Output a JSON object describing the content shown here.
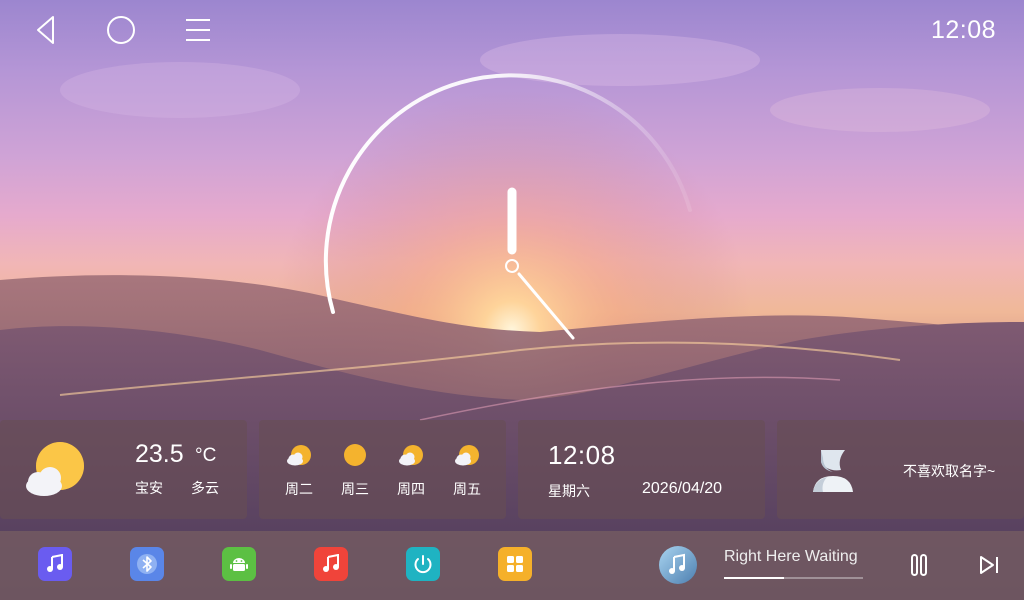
{
  "status": {
    "time": "12:08"
  },
  "weather": {
    "temp": "23.5",
    "unit": "°C",
    "city": "宝安",
    "condition": "多云"
  },
  "forecast": [
    {
      "day": "周二",
      "icon": "partly-cloudy-icon"
    },
    {
      "day": "周三",
      "icon": "sun-icon"
    },
    {
      "day": "周四",
      "icon": "partly-cloudy-icon"
    },
    {
      "day": "周五",
      "icon": "partly-cloudy-icon"
    }
  ],
  "datetime": {
    "time": "12:08",
    "weekday": "星期六",
    "date": "2026/04/20"
  },
  "user": {
    "name": "不喜欢取名字~"
  },
  "dock": {
    "apps": [
      {
        "name": "music-app-icon",
        "color": "#6a5cf0"
      },
      {
        "name": "bluetooth-app-icon",
        "color": "#5a86e8"
      },
      {
        "name": "android-app-icon",
        "color": "#5cc043"
      },
      {
        "name": "music-player-app-icon",
        "color": "#f0443a"
      },
      {
        "name": "power-app-icon",
        "color": "#1fb3c2"
      },
      {
        "name": "apps-grid-icon",
        "color": "#f5b02a"
      }
    ],
    "player": {
      "song": "Right Here Waiting",
      "progress": 0.43
    }
  },
  "colors": {
    "accent": "#ffffff",
    "panel": "#684e54"
  }
}
